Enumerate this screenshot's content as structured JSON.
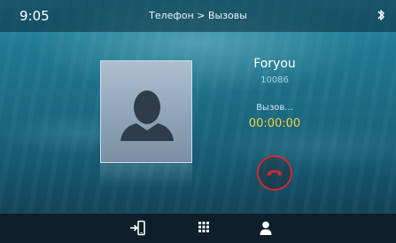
{
  "status_bar": {
    "time": "9:05",
    "breadcrumb": "Телефон > Вызовы",
    "bluetooth_icon": "bluetooth-icon"
  },
  "call": {
    "caller_name": "Foryou",
    "caller_number": "10086",
    "status": "Вызов...",
    "timer": "00:00:00",
    "avatar_icon": "contact-placeholder-icon",
    "hangup_icon": "hang-up-icon"
  },
  "bottom_nav": {
    "items": [
      {
        "icon": "transfer-to-phone-icon"
      },
      {
        "icon": "keypad-icon"
      },
      {
        "icon": "contacts-icon"
      }
    ]
  },
  "colors": {
    "timer": "#f3d43a",
    "hangup": "#d2282e",
    "bottom_bar": "#0d1f2a"
  }
}
